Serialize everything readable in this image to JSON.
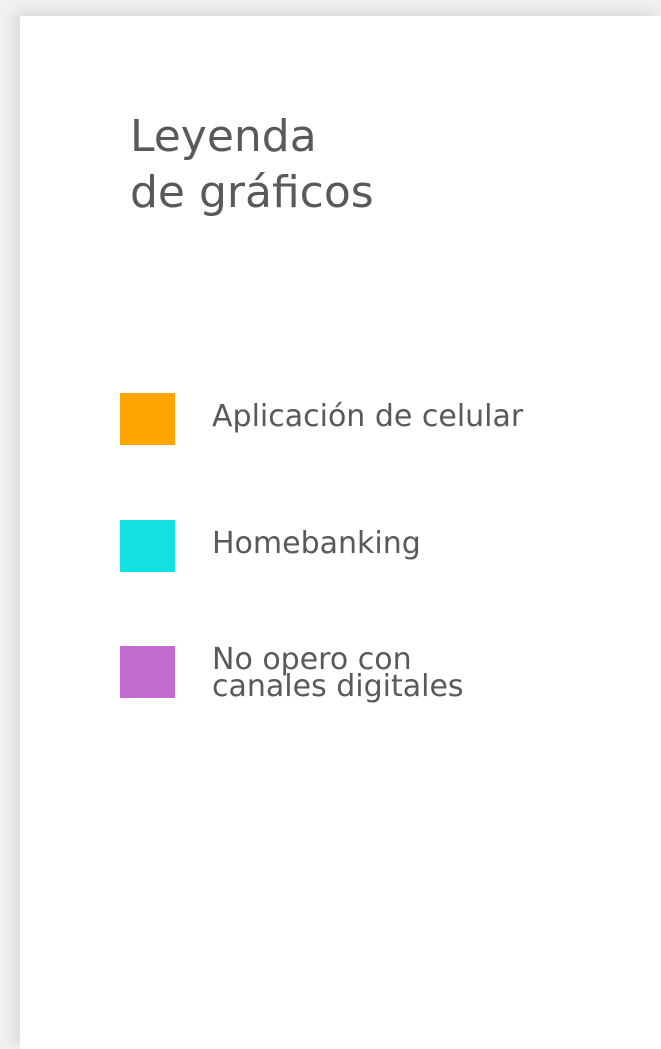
{
  "chart_data": {
    "type": "legend",
    "title": [
      "Leyenda",
      "de gráficos"
    ],
    "legend": [
      {
        "name": "Aplicación de celular",
        "color": "#FFA500"
      },
      {
        "name": "Homebanking",
        "color": "#13E0E0"
      },
      {
        "name": "No opero con\ncanales digitales",
        "color": "#C26ACF"
      }
    ]
  }
}
